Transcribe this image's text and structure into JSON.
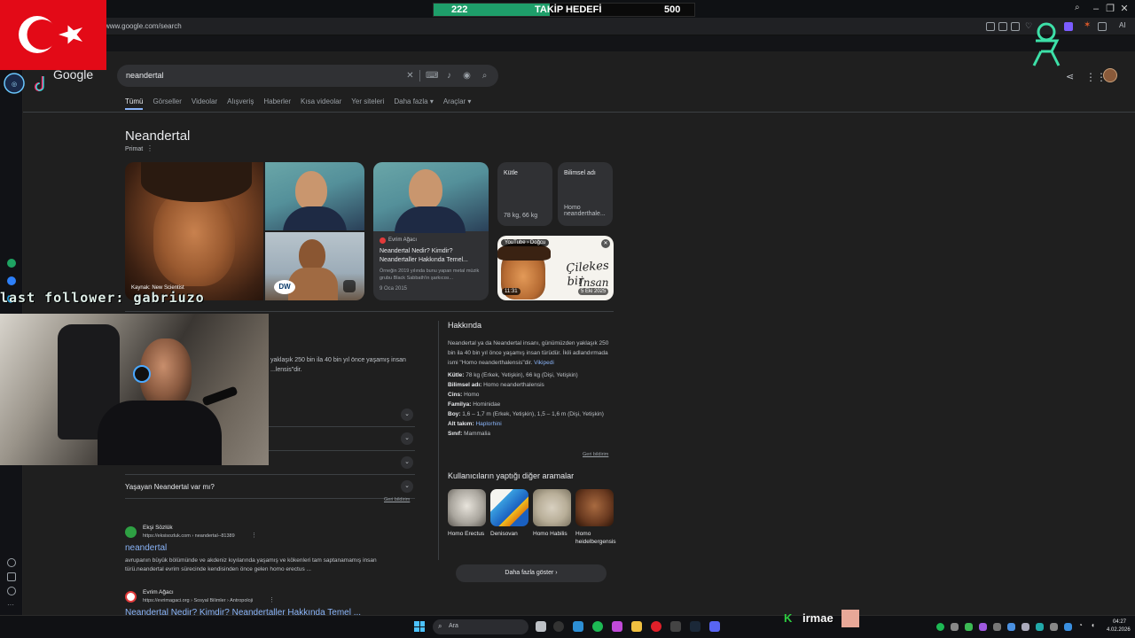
{
  "stream": {
    "goal_current": "222",
    "goal_title": "TAKİP HEDEFİ",
    "goal_target": "500",
    "goal_progress": 0.444,
    "last_follower": "last follower: gabriuzo",
    "chat_username": "irmae",
    "chat_badge": "K"
  },
  "browser": {
    "url": "www.google.com/search"
  },
  "google": {
    "logo": "Google",
    "query": "neandertal",
    "tabs": [
      "Tümü",
      "Görseller",
      "Videolar",
      "Alışveriş",
      "Haberler",
      "Kısa videolar",
      "Yer siteleri",
      "Daha fazla ▾",
      "Araçlar ▾"
    ]
  },
  "knowledge_panel": {
    "title": "Neandertal",
    "subtitle": "Primat",
    "image_caption": "Kaynak: New Scientist",
    "dw_logo": "DW",
    "evrim_card": {
      "source": "Evrim Ağacı",
      "title": "Neandertal Nedir? Kimdir? Neandertaller Hakkında Temel...",
      "snippet": "Örneğin 2019 yılında bunu yapan metal müzik grubu Black Sabbath'in şarkıcısı...",
      "date": "9 Oca 2015"
    },
    "kutle": {
      "label": "Kütle",
      "value": "78 kg, 66 kg"
    },
    "bilimsel": {
      "label": "Bilimsel adı",
      "value": "Homo neanderthale..."
    },
    "yt_card": {
      "badge": "YouTube › Doğcu",
      "duration": "11:31",
      "date": "5 Eki 2025",
      "handwriting_1": "Çilekes bir",
      "handwriting_2": "İnsan"
    }
  },
  "about": {
    "title": "Hakkında",
    "description": "Neandertal ya da Neandertal insanı, günümüzden yaklaşık 250 bin ila 40 bin yıl önce yaşamış insan türüdür. İkili adlandırmada ismi \"Homo neanderthalensis\"dir.",
    "description_link": "Vikipedi",
    "facts": [
      {
        "label": "Kütle:",
        "value": "78 kg (Erkek, Yetişkin), 66 kg (Dişi, Yetişkin)"
      },
      {
        "label": "Bilimsel adı:",
        "value": "Homo neanderthalensis"
      },
      {
        "label": "Cins:",
        "value": "Homo"
      },
      {
        "label": "Familya:",
        "value": "Hominidae"
      },
      {
        "label": "Boy:",
        "value": "1,6 – 1,7 m (Erkek, Yetişkin), 1,5 – 1,6 m (Dişi, Yetişkin)"
      },
      {
        "label": "Alt takım:",
        "value": "Haplorhini"
      },
      {
        "label": "Sınıf:",
        "value": "Mammalia"
      }
    ],
    "feedback": "Geri bildirim"
  },
  "related": {
    "title": "Kullanıcıların yaptığı diğer aramalar",
    "items": [
      "Homo Erectus",
      "Denisovan",
      "Homo Habilis",
      "Homo heidelbergensis"
    ],
    "more_button": "Daha fazla göster  ›"
  },
  "questions": {
    "partial_text": "yaklaşık 250 bin ila 40 bin yıl önce yaşamış insan ...lensis\"dir.",
    "visible_question": "Yaşayan Neandertal var mı?",
    "feedback": "Geri bildirim"
  },
  "results": [
    {
      "site": "Ekşi Sözlük",
      "url": "https://eksisozluk.com › neandertal--81389",
      "title": "neandertal",
      "snippet_1": "avrupanın büyük bölümünde ve akdeniz kıyılarında yaşamış ve kökenleri tam saptanamamış insan",
      "snippet_2": "türü.neandertal evrim sürecinde kendisinden önce gelen homo erectus ..."
    },
    {
      "site": "Evrim Ağacı",
      "url": "https://evrimagaci.org › Sosyal Bilimler › Antropoloji",
      "title": "Neandertal Nedir? Kimdir? Neandertaller Hakkında Temel ..."
    }
  ],
  "taskbar": {
    "search_placeholder": "Ara",
    "time": "04:27",
    "date": "4.02.2026"
  }
}
